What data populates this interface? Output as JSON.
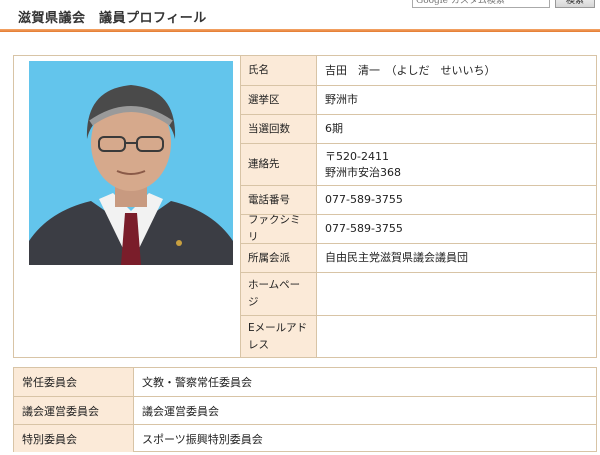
{
  "header": {
    "title": "滋賀県議会　議員プロフィール",
    "search_placeholder": "Google カスタム検索",
    "search_button": "検索",
    "accent_color": "#e47a2f"
  },
  "profile": {
    "photo_icon": "member-portrait",
    "fields": [
      {
        "label": "氏名",
        "lines": [
          "吉田　清一　（よしだ　せいいち）"
        ]
      },
      {
        "label": "選挙区",
        "lines": [
          "野洲市"
        ]
      },
      {
        "label": "当選回数",
        "lines": [
          "6期"
        ]
      },
      {
        "label": "連絡先",
        "lines": [
          "〒520-2411",
          "野洲市安治368"
        ]
      },
      {
        "label": "電話番号",
        "lines": [
          "077-589-3755"
        ]
      },
      {
        "label": "ファクシミリ",
        "lines": [
          "077-589-3755"
        ]
      },
      {
        "label": "所属会派",
        "lines": [
          "自由民主党滋賀県議会議員団"
        ]
      },
      {
        "label": "ホームページ",
        "lines": [
          ""
        ]
      },
      {
        "label": "Eメールアドレス",
        "lines": [
          ""
        ]
      }
    ]
  },
  "committees": [
    {
      "label": "常任委員会",
      "value": "文教・警察常任委員会"
    },
    {
      "label": "議会運営委員会",
      "value": "議会運営委員会"
    },
    {
      "label": "特別委員会",
      "value": "スポーツ振興特別委員会"
    }
  ]
}
